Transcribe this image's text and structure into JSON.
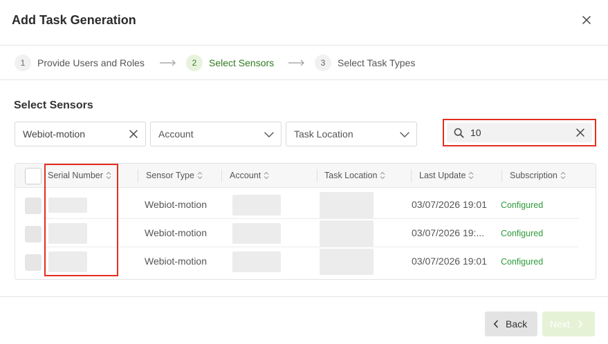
{
  "dialog": {
    "title": "Add Task Generation"
  },
  "steps": [
    {
      "number": "1",
      "label": "Provide Users and Roles",
      "state": "done"
    },
    {
      "number": "2",
      "label": "Select Sensors",
      "state": "active"
    },
    {
      "number": "3",
      "label": "Select Task Types",
      "state": "pending"
    }
  ],
  "section": {
    "title": "Select Sensors"
  },
  "filters": {
    "sensor_type": {
      "value": "Webiot-motion"
    },
    "account": {
      "placeholder": "Account"
    },
    "task_location": {
      "placeholder": "Task Location"
    }
  },
  "search": {
    "value": "10"
  },
  "table": {
    "columns": [
      "Serial Number",
      "Sensor Type",
      "Account",
      "Task Location",
      "Last Update",
      "Subscription"
    ],
    "rows": [
      {
        "sensor_type": "Webiot-motion",
        "last_update": "03/07/2026 19:01",
        "subscription": "Configured"
      },
      {
        "sensor_type": "Webiot-motion",
        "last_update": "03/07/2026 19:...",
        "subscription": "Configured"
      },
      {
        "sensor_type": "Webiot-motion",
        "last_update": "03/07/2026 19:01",
        "subscription": "Configured"
      }
    ]
  },
  "footer": {
    "back_label": "Back",
    "next_label": "Next"
  },
  "colors": {
    "accent": "#2f7a1f",
    "annotation": "#e32d1e",
    "status_ok": "#2c9a3a"
  }
}
